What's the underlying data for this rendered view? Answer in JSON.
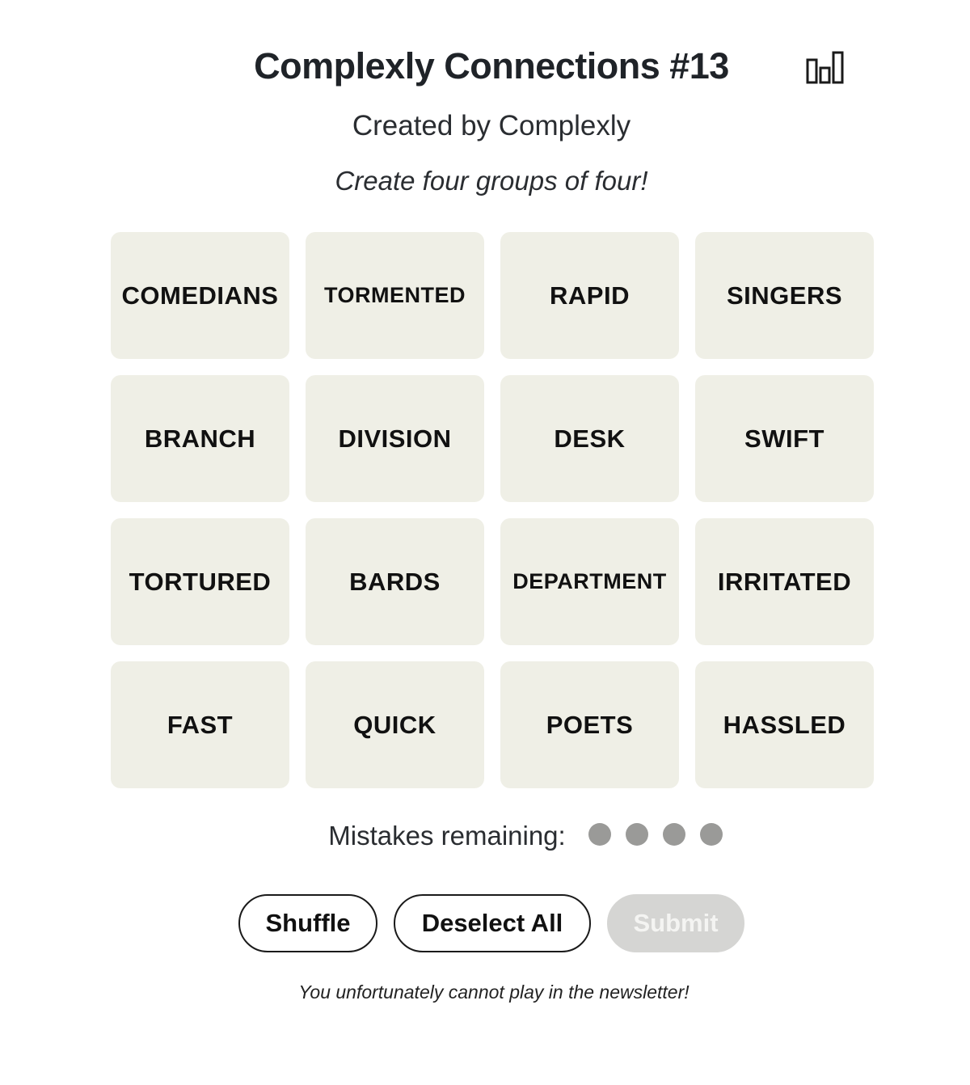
{
  "header": {
    "title": "Complexly Connections #13",
    "stats_icon": "bar-chart-icon",
    "subtitle": "Created by Complexly",
    "instructions": "Create four groups of four!"
  },
  "board": {
    "tiles": [
      "COMEDIANS",
      "TORMENTED",
      "RAPID",
      "SINGERS",
      "BRANCH",
      "DIVISION",
      "DESK",
      "SWIFT",
      "TORTURED",
      "BARDS",
      "DEPARTMENT",
      "IRRITATED",
      "FAST",
      "QUICK",
      "POETS",
      "HASSLED"
    ],
    "tile_color": "#efefe6"
  },
  "mistakes": {
    "label": "Mistakes remaining:",
    "remaining": 4,
    "dot_color": "#9a9a98"
  },
  "controls": {
    "shuffle_label": "Shuffle",
    "deselect_label": "Deselect All",
    "submit_label": "Submit",
    "submit_disabled": true
  },
  "footer": {
    "note": "You unfortunately cannot play in the newsletter!"
  }
}
